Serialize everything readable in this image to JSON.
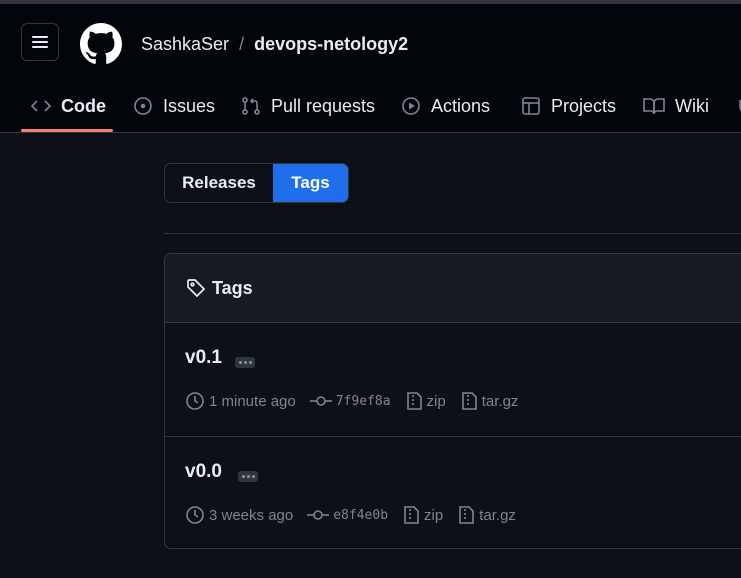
{
  "header": {
    "owner": "SashkaSer",
    "separator": "/",
    "repo": "devops-netology2"
  },
  "tabs": [
    {
      "label": "Code",
      "icon": "code-icon",
      "active": true
    },
    {
      "label": "Issues",
      "icon": "issue-opened-icon"
    },
    {
      "label": "Pull requests",
      "icon": "git-pull-request-icon"
    },
    {
      "label": "Actions",
      "icon": "play-icon"
    },
    {
      "label": "Projects",
      "icon": "table-icon"
    },
    {
      "label": "Wiki",
      "icon": "book-icon"
    }
  ],
  "segmented": {
    "releases_label": "Releases",
    "tags_label": "Tags",
    "selected": "Tags"
  },
  "tags_box": {
    "title": "Tags",
    "items": [
      {
        "name": "v0.1",
        "time": "1 minute ago",
        "commit": "7f9ef8a",
        "zip": "zip",
        "targz": "tar.gz"
      },
      {
        "name": "v0.0",
        "time": "3 weeks ago",
        "commit": "e8f4e0b",
        "zip": "zip",
        "targz": "tar.gz"
      }
    ]
  },
  "colors": {
    "background": "#0d1117",
    "header_bg": "#010409",
    "accent_blue": "#1f6feb",
    "tab_underline": "#f78166",
    "border": "#30363d",
    "muted_text": "#7d8590"
  }
}
